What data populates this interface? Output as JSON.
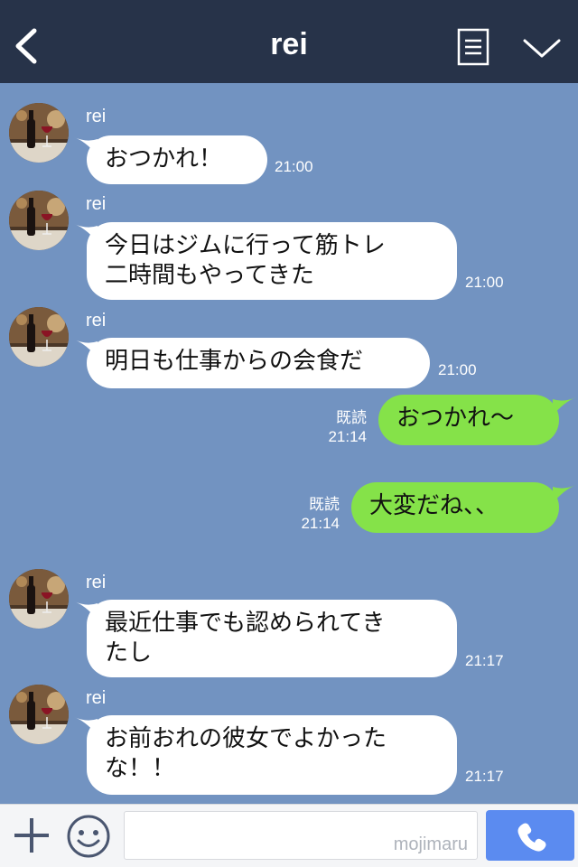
{
  "header": {
    "title": "rei"
  },
  "colors": {
    "header_bg": "#273349",
    "chat_bg": "#7293c1",
    "incoming_bubble": "#ffffff",
    "outgoing_bubble": "#85e249",
    "call_button": "#5b8bf0"
  },
  "icons": {
    "back": "chevron-left-icon",
    "menu": "note-icon",
    "collapse": "chevron-down-icon",
    "plus": "plus-icon",
    "emoji": "smiley-icon",
    "call": "phone-icon"
  },
  "messages": [
    {
      "sender": "rei",
      "direction": "incoming",
      "lines": [
        "おつかれ！"
      ],
      "time": "21:00"
    },
    {
      "sender": "rei",
      "direction": "incoming",
      "lines": [
        "今日はジムに行って筋トレ",
        "二時間もやってきた"
      ],
      "time": "21:00"
    },
    {
      "sender": "rei",
      "direction": "incoming",
      "lines": [
        "明日も仕事からの会食だ"
      ],
      "time": "21:00"
    },
    {
      "direction": "outgoing",
      "lines": [
        "おつかれ〜"
      ],
      "read": "既読",
      "time": "21:14"
    },
    {
      "direction": "outgoing",
      "lines": [
        "大変だね、、"
      ],
      "read": "既読",
      "time": "21:14"
    },
    {
      "sender": "rei",
      "direction": "incoming",
      "lines": [
        "最近仕事でも認められてき",
        "たし"
      ],
      "time": "21:17"
    },
    {
      "sender": "rei",
      "direction": "incoming",
      "lines": [
        "お前おれの彼女でよかった",
        "な！！"
      ],
      "time": "21:17"
    }
  ],
  "footer": {
    "input_value": "",
    "watermark": "mojimaru"
  }
}
